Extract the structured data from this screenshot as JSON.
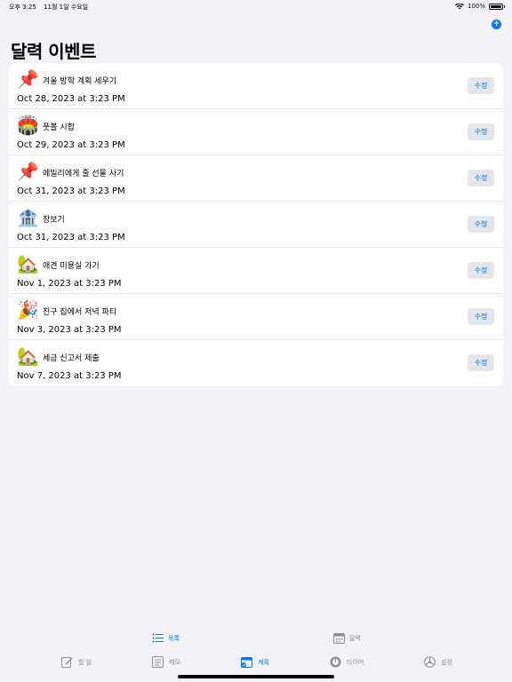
{
  "status": {
    "time": "오후 3:25",
    "date": "11월 1일 수요일",
    "battery": "100%"
  },
  "header": {
    "title": "달력 이벤트",
    "add_label": "+"
  },
  "events": [
    {
      "emoji": "📌",
      "title": "겨울 방학 계획 세우기",
      "date": "Oct 28, 2023 at 3:23 PM",
      "edit_label": "수정"
    },
    {
      "emoji": "🏟️",
      "title": "풋볼 시합",
      "date": "Oct 29, 2023 at 3:23 PM",
      "edit_label": "수정"
    },
    {
      "emoji": "📌",
      "title": "에밀리에게 줄 선물 사기",
      "date": "Oct 31, 2023 at 3:23 PM",
      "edit_label": "수정"
    },
    {
      "emoji": "🏦",
      "title": "장보기",
      "date": "Oct 31, 2023 at 3:23 PM",
      "edit_label": "수정"
    },
    {
      "emoji": "🏡",
      "title": "애견 미용실 가기",
      "date": "Nov 1, 2023 at 3:23 PM",
      "edit_label": "수정"
    },
    {
      "emoji": "🎉",
      "title": "친구 집에서 저녁 파티",
      "date": "Nov 3, 2023 at 3:23 PM",
      "edit_label": "수정"
    },
    {
      "emoji": "🏡",
      "title": "세금 신고서 제출",
      "date": "Nov 7, 2023 at 3:23 PM",
      "edit_label": "수정"
    }
  ],
  "subtabs": {
    "list": "목록",
    "calendar": "달력"
  },
  "tabs": {
    "todo": "할 일",
    "memo": "메모",
    "plan": "계획",
    "timer": "타이머",
    "settings": "설정"
  },
  "colors": {
    "accent": "#007aff",
    "inactive": "#8e8e93",
    "background": "#f2f2f7"
  }
}
